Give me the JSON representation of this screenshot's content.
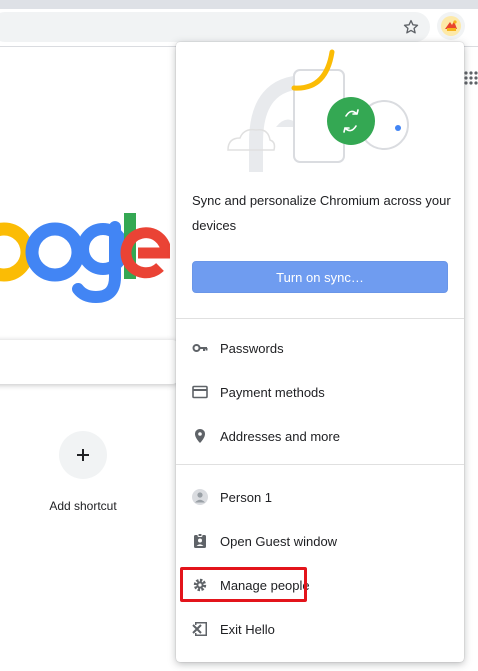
{
  "colors": {
    "accent": "#6f9cf0",
    "highlight": "#e3141b",
    "text": "#202124",
    "icon": "#5f6368"
  },
  "toolbar": {
    "bookmark_icon": "star-icon",
    "profile_icon": "avatar"
  },
  "ntp": {
    "logo_text": "oogle",
    "shortcut": {
      "label": "Add shortcut",
      "icon": "plus-icon"
    }
  },
  "profile_menu": {
    "sync_prompt": "Sync and personalize Chromium across your devices",
    "sync_button": "Turn on sync…",
    "items": [
      {
        "label": "Passwords",
        "icon": "key-icon"
      },
      {
        "label": "Payment methods",
        "icon": "credit-card-icon"
      },
      {
        "label": "Addresses and more",
        "icon": "location-pin-icon"
      }
    ],
    "person": {
      "label": "Person 1",
      "icon": "person-avatar-icon"
    },
    "actions": [
      {
        "label": "Open Guest window",
        "icon": "guest-badge-icon"
      },
      {
        "label": "Manage people",
        "icon": "gear-icon",
        "highlighted": true
      },
      {
        "label": "Exit Hello",
        "icon": "exit-icon"
      }
    ]
  }
}
